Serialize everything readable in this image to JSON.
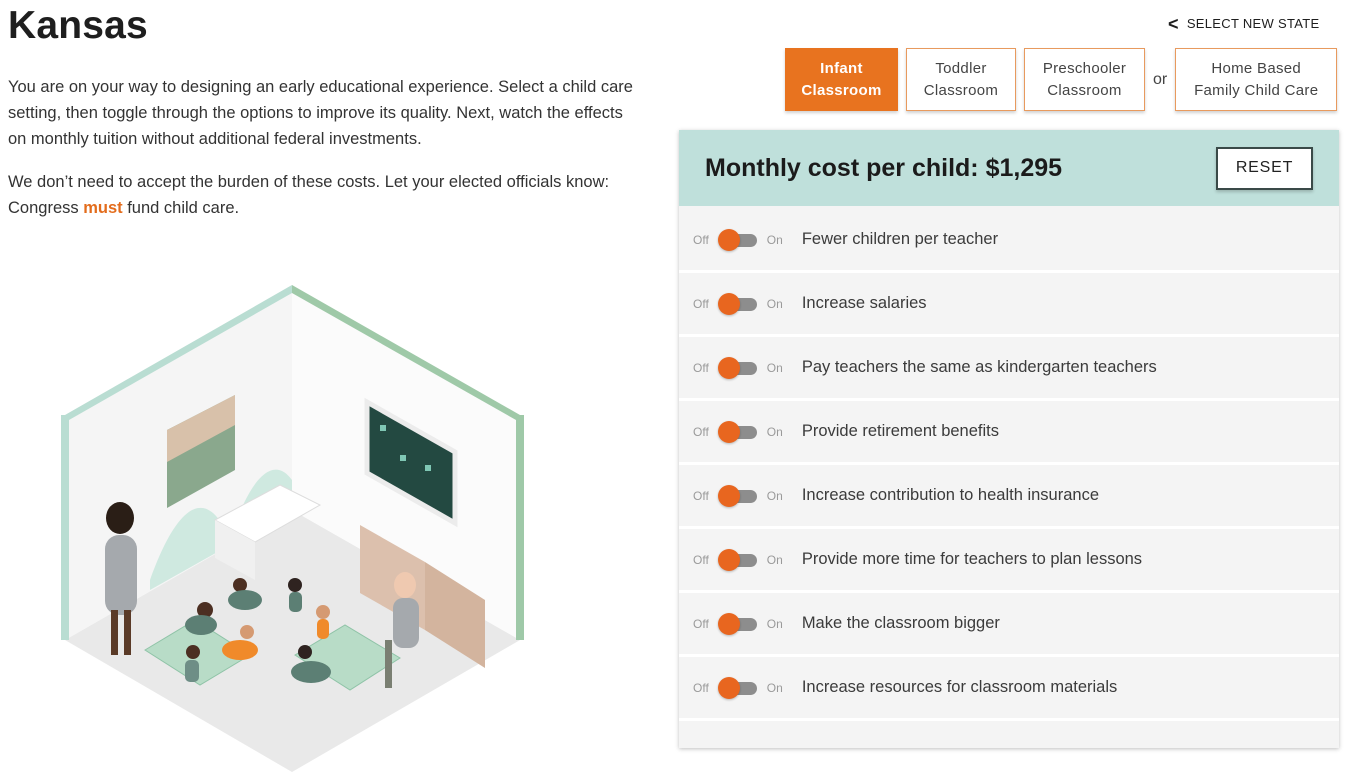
{
  "page": {
    "state_name": "Kansas",
    "intro_paragraph": "You are on your way to designing an early educational experience. Select a child care setting, then toggle through the options to improve its quality. Next, watch the effects on monthly tuition without additional federal investments.",
    "cta_prefix": "We don’t need to accept the burden of these costs. Let your elected officials know: Congress ",
    "cta_emphasis": "must",
    "cta_suffix": " fund child care."
  },
  "header": {
    "select_state_label": "SELECT NEW STATE",
    "back_icon": "chevron-left-icon"
  },
  "tabs": [
    {
      "line1": "Infant",
      "line2": "Classroom",
      "active": true
    },
    {
      "line1": "Toddler",
      "line2": "Classroom",
      "active": false
    },
    {
      "line1": "Preschooler",
      "line2": "Classroom",
      "active": false
    },
    {
      "line1": "Home Based",
      "line2": "Family Child Care",
      "active": false
    }
  ],
  "tabs_separator": "or",
  "panel": {
    "cost_label": "Monthly cost per child: $1,295",
    "reset_label": "RESET",
    "off_label": "Off",
    "on_label": "On",
    "options": [
      {
        "label": "Fewer children per teacher",
        "state": "off"
      },
      {
        "label": "Increase salaries",
        "state": "off"
      },
      {
        "label": "Pay teachers the same as kindergarten teachers",
        "state": "off"
      },
      {
        "label": "Provide retirement benefits",
        "state": "off"
      },
      {
        "label": "Increase contribution to health insurance",
        "state": "off"
      },
      {
        "label": "Provide more time for teachers to plan lessons",
        "state": "off"
      },
      {
        "label": "Make the classroom bigger",
        "state": "off"
      },
      {
        "label": "Increase resources for classroom materials",
        "state": "off"
      }
    ]
  },
  "colors": {
    "accent": "#e8731f",
    "panel_header": "#bfe0db",
    "toggle_track": "#8d8d8d"
  }
}
